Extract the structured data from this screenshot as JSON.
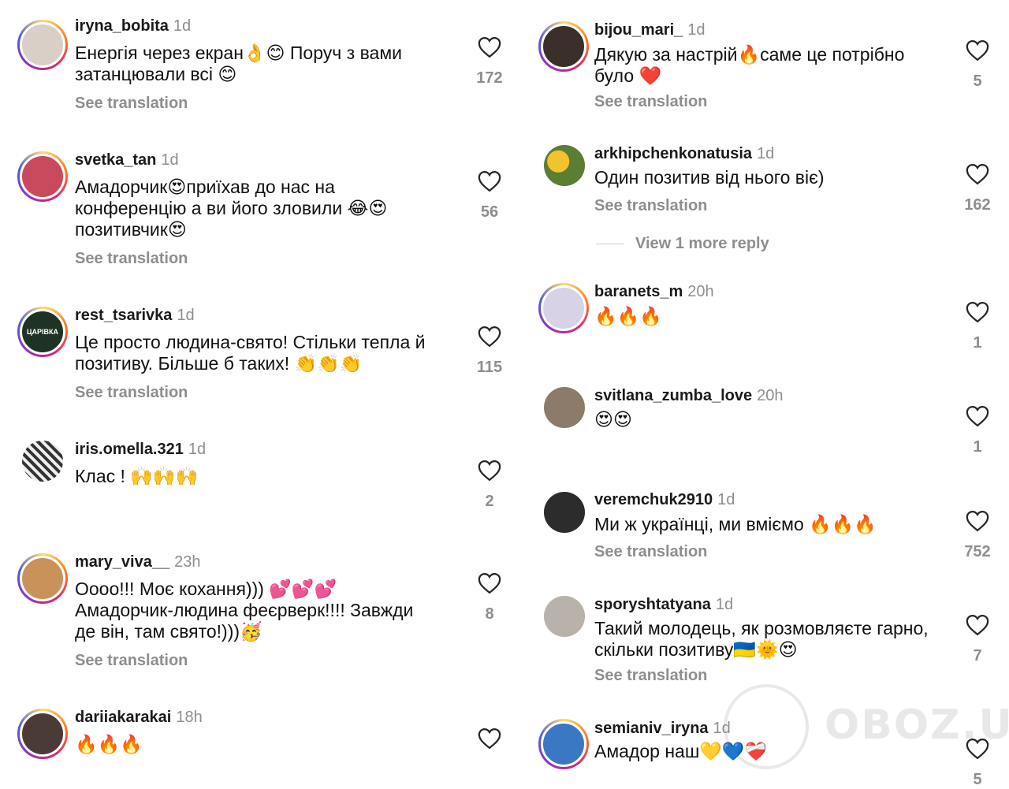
{
  "see_translation_label": "See translation",
  "left": [
    {
      "username": "iryna_bobita",
      "time": "1d",
      "lines": [
        "Енергія через екран👌😊 Поруч з вами",
        "затанцювали всі 😊"
      ],
      "translation": true,
      "likes": "172",
      "avatar_color": "#d9cfc7"
    },
    {
      "username": "svetka_tan",
      "time": "1d",
      "lines": [
        "Амадорчик😍приїхав до нас на",
        "конференцію а ви його зловили 😂😍",
        "позитивчик😍"
      ],
      "translation": true,
      "likes": "56",
      "avatar_color": "#c94a5c"
    },
    {
      "username": "rest_tsarivka",
      "time": "1d",
      "lines": [
        "Це просто людина-свято! Стільки тепла й",
        "позитиву. Більше б таких! 👏👏👏"
      ],
      "translation": true,
      "likes": "115",
      "avatar_color": "#1e3323",
      "avatar_text": "ЦАРІВКА"
    },
    {
      "username": "iris.omella.321",
      "time": "1d",
      "lines": [
        "Клас ! 🙌🙌🙌"
      ],
      "translation": false,
      "likes": "2",
      "avatar_color": "#6a6a6a"
    },
    {
      "username": "mary_viva__",
      "time": "23h",
      "lines": [
        "Оооо!!! Моє кохання))) 💕💕💕",
        "Амадорчик-людина феєрверк!!!! Завжди",
        "де він, там свято!)))🥳"
      ],
      "translation": true,
      "likes": "8",
      "avatar_color": "#c9925a"
    },
    {
      "username": "dariiakarakai",
      "time": "18h",
      "lines": [
        "🔥🔥🔥"
      ],
      "translation": false,
      "likes": "",
      "avatar_color": "#4a3b36"
    }
  ],
  "right": [
    {
      "username": "bijou_mari_",
      "time": "1d",
      "lines": [
        "Дякую за настрій🔥саме це потрібно",
        "було ❤️"
      ],
      "translation": true,
      "likes": "5",
      "avatar_color": "#3b2f2a"
    },
    {
      "username": "arkhipchenkonatusia",
      "time": "1d",
      "lines": [
        "Один позитив від нього віє)"
      ],
      "translation": true,
      "likes": "162",
      "avatar_color": "#c9a23a"
    },
    {
      "username": "baranets_m",
      "time": "20h",
      "lines": [
        "🔥🔥🔥"
      ],
      "translation": false,
      "likes": "1",
      "avatar_color": "#d8d2e6"
    },
    {
      "username": "svitlana_zumba_love",
      "time": "20h",
      "lines": [
        "😍😍"
      ],
      "translation": false,
      "likes": "1",
      "avatar_color": "#8c7b6a"
    },
    {
      "username": "veremchuk2910",
      "time": "1d",
      "lines": [
        "Ми ж українці, ми вміємо 🔥🔥🔥"
      ],
      "translation": true,
      "likes": "752",
      "avatar_color": "#2c2c2c"
    },
    {
      "username": "sporyshtatyana",
      "time": "1d",
      "lines": [
        "Такий молодець, як розмовляєте гарно,",
        "скільки позитиву🇺🇦🌞😍"
      ],
      "translation": true,
      "likes": "7",
      "avatar_color": "#b8b2aa"
    },
    {
      "username": "semianiv_iryna",
      "time": "1d",
      "lines": [
        "Амадор наш💛💙❤️‍🩹"
      ],
      "translation": false,
      "likes": "5",
      "avatar_color": "#3a78c4"
    }
  ],
  "view_more_label": "View 1 more reply",
  "watermark_text": "OBOZ.UA"
}
